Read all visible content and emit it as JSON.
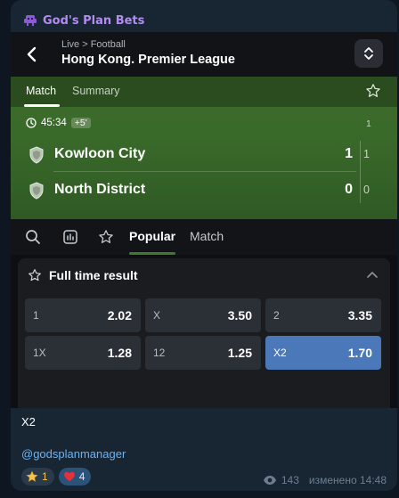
{
  "channel": {
    "name": "God's Plan Bets",
    "icon": "alien-icon"
  },
  "screenshot": {
    "header": {
      "breadcrumb": "Live > Football",
      "league": "Hong Kong. Premier League"
    },
    "match_tabs": [
      "Match",
      "Summary"
    ],
    "clock": {
      "time": "45:34",
      "added": "+5'"
    },
    "period_label": "1",
    "teams": [
      {
        "name": "Kowloon City",
        "score": "1",
        "period_score": "1"
      },
      {
        "name": "North District",
        "score": "0",
        "period_score": "0"
      }
    ],
    "filters": {
      "popular": "Popular",
      "match": "Match"
    },
    "market": {
      "title": "Full time result",
      "odds": [
        {
          "label": "1",
          "value": "2.02",
          "selected": false
        },
        {
          "label": "X",
          "value": "3.50",
          "selected": false
        },
        {
          "label": "2",
          "value": "3.35",
          "selected": false
        },
        {
          "label": "1X",
          "value": "1.28",
          "selected": false
        },
        {
          "label": "12",
          "value": "1.25",
          "selected": false
        },
        {
          "label": "X2",
          "value": "1.70",
          "selected": true
        }
      ]
    }
  },
  "caption": "X2",
  "mention": "@godsplanmanager",
  "reactions": [
    {
      "emoji": "star",
      "count": "1"
    },
    {
      "emoji": "heart",
      "count": "4"
    }
  ],
  "views": "143",
  "edited_time": "изменено 14:48",
  "colors": {
    "accent_link": "#6ab3f3",
    "channel_name": "#b38cf0",
    "selected_odd": "#4a78b8",
    "pitch_green": "#3d6a2c"
  }
}
